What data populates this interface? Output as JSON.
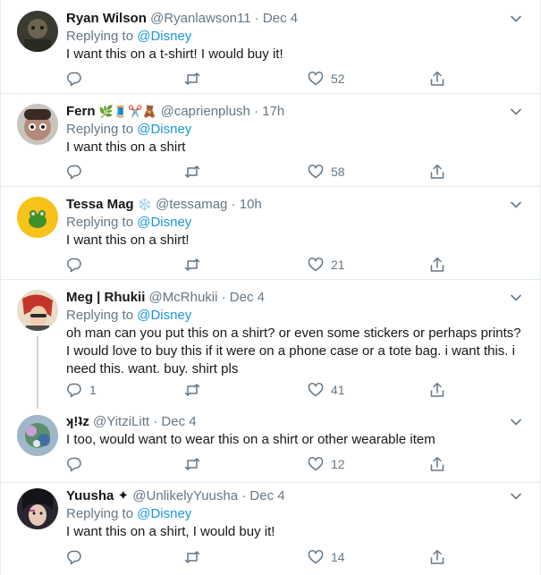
{
  "tweets": [
    {
      "name": "Ryan Wilson",
      "emoji": "",
      "handle": "@Ryanlawson11",
      "time": "Dec 4",
      "replying_label": "Replying to",
      "replying_to": "@Disney",
      "text": "I want this on a t-shirt! I would buy it!",
      "replies": "",
      "retweets": "",
      "likes": "52"
    },
    {
      "name": "Fern",
      "emoji": "🌿🧵✂️🧸",
      "handle": "@caprienplush",
      "time": "17h",
      "replying_label": "Replying to",
      "replying_to": "@Disney",
      "text": "I want this on a shirt",
      "replies": "",
      "retweets": "",
      "likes": "58"
    },
    {
      "name": "Tessa Mag",
      "emoji": "❄️",
      "handle": "@tessamag",
      "time": "10h",
      "replying_label": "Replying to",
      "replying_to": "@Disney",
      "text": "I want this on a shirt!",
      "replies": "",
      "retweets": "",
      "likes": "21"
    },
    {
      "name": "Meg | Rhukii",
      "emoji": "",
      "handle": "@McRhukii",
      "time": "Dec 4",
      "replying_label": "Replying to",
      "replying_to": "@Disney",
      "text": "oh man can you put this on a shirt? or even some stickers or perhaps prints? I would love to buy  this if it were on a phone case or a tote bag. i want this. i need this. want. buy. shirt pls",
      "replies": "1",
      "retweets": "",
      "likes": "41"
    },
    {
      "name": "ʞ!ʇz",
      "emoji": "",
      "handle": "@YitziLitt",
      "time": "Dec 4",
      "replying_label": "",
      "replying_to": "",
      "text": "I too, would want to wear this on a shirt or other wearable item",
      "replies": "",
      "retweets": "",
      "likes": "12"
    },
    {
      "name": "Yuusha",
      "emoji": "✦",
      "handle": "@UnlikelyYuusha",
      "time": "Dec 4",
      "replying_label": "Replying to",
      "replying_to": "@Disney",
      "text": "I want this on a shirt, I would buy it!",
      "replies": "",
      "retweets": "",
      "likes": "14"
    }
  ],
  "separator": "·",
  "icons": {
    "reply": "reply-icon",
    "retweet": "retweet-icon",
    "like": "like-icon",
    "share": "share-icon",
    "menu": "chevron-down-icon"
  },
  "colors": {
    "text": "#14171a",
    "muted": "#657786",
    "link": "#1b95e0",
    "border": "#e6ecf0"
  }
}
